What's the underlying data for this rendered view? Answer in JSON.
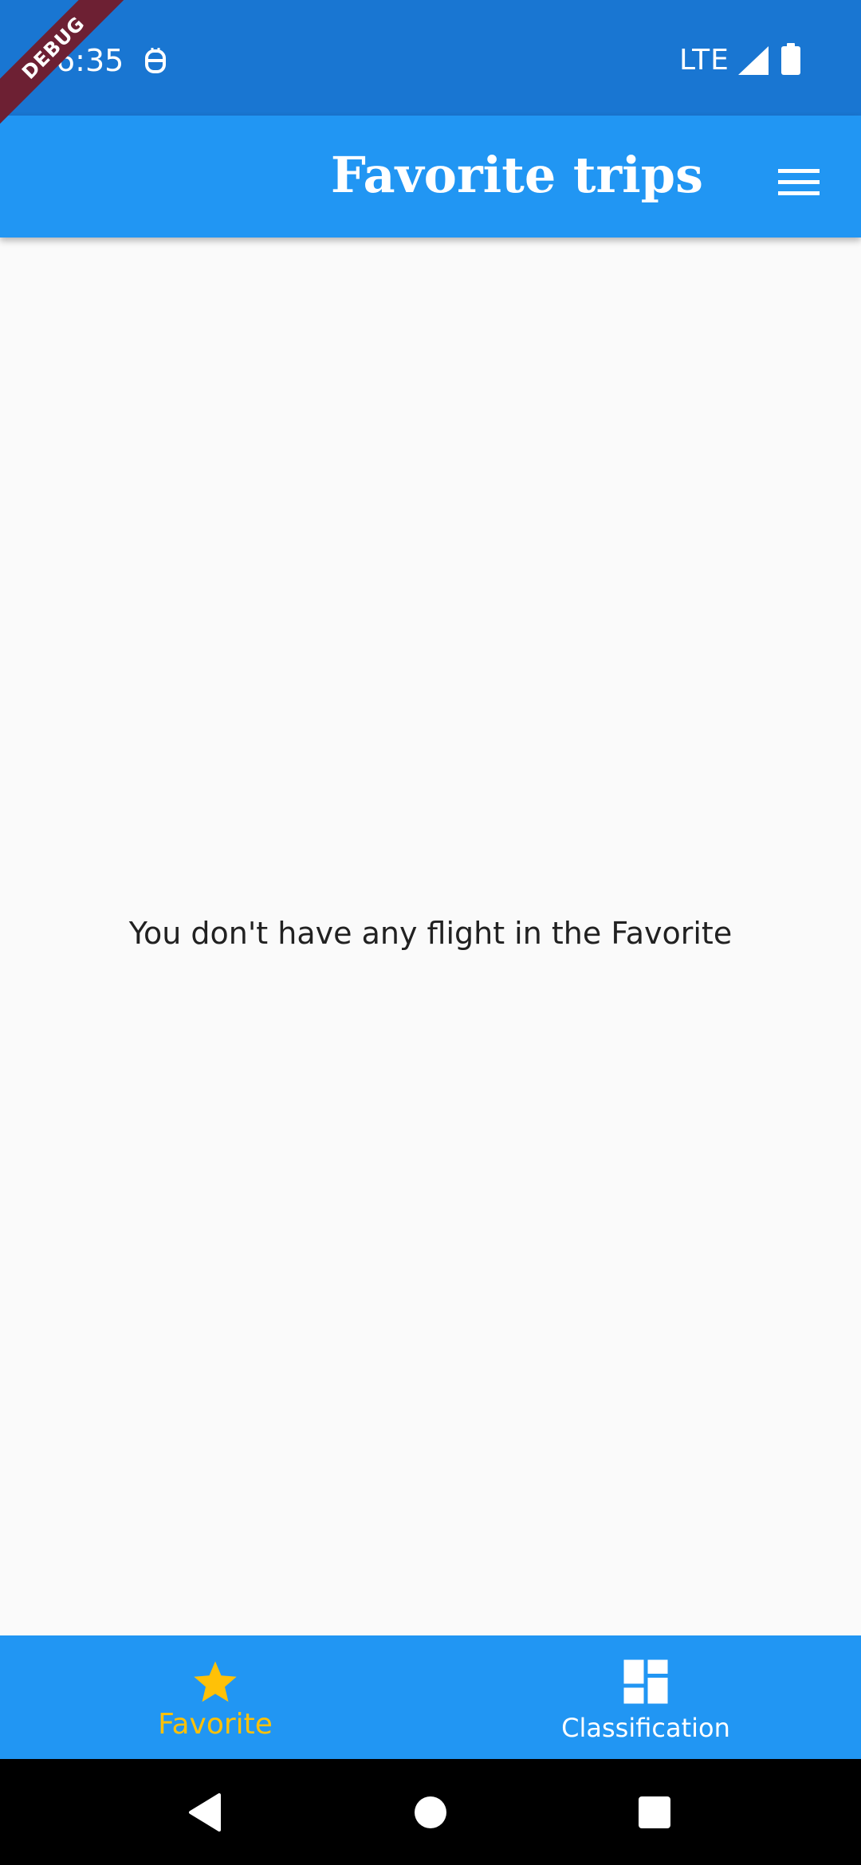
{
  "status_bar": {
    "time": "6:35",
    "network": "LTE",
    "notification_icon": "notification-icon",
    "signal_icon": "cell-signal-icon",
    "battery_icon": "battery-full-icon"
  },
  "debug_banner": "DEBUG",
  "app_bar": {
    "title": "Favorite trips",
    "menu_icon": "hamburger-menu-icon"
  },
  "content": {
    "empty_message": "You don't have any flight in the Favorite"
  },
  "bottom_nav": {
    "items": [
      {
        "label": "Favorite",
        "icon": "star-icon",
        "selected": true
      },
      {
        "label": "Classification",
        "icon": "dashboard-icon",
        "selected": false
      }
    ]
  },
  "system_nav": {
    "back_icon": "back-triangle-icon",
    "home_icon": "home-circle-icon",
    "recents_icon": "recents-square-icon"
  },
  "colors": {
    "status_bar": "#1976d2",
    "app_bar": "#2196f3",
    "background": "#fafafa",
    "selected_nav": "#ffc107",
    "unselected_nav": "#ffffff",
    "debug_banner": "#6d2033"
  }
}
